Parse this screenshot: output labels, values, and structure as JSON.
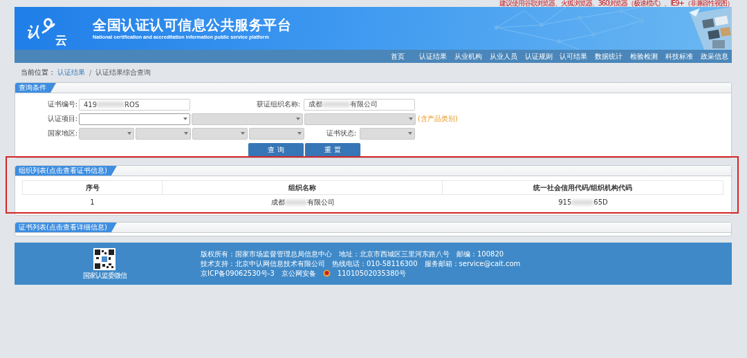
{
  "browser_notice": "建议使用谷歌浏览器、火狐浏览器、360浏览器（极速模式）、IE9+（非兼容性视图）",
  "header": {
    "logo_chars": [
      "认",
      "云"
    ],
    "title": "全国认证认可信息公共服务平台",
    "subtitle": "National certification and accreditation information public service platform"
  },
  "nav": [
    {
      "label": "首页",
      "selected": false
    },
    {
      "label": "认证结果",
      "selected": false
    },
    {
      "label": "从业机构",
      "selected": false
    },
    {
      "label": "从业人员",
      "selected": false
    },
    {
      "label": "认证规则",
      "selected": false
    },
    {
      "label": "认可结果",
      "selected": false
    },
    {
      "label": "数据统计",
      "selected": false
    },
    {
      "label": "检验检测",
      "selected": false
    },
    {
      "label": "科技标准",
      "selected": false
    },
    {
      "label": "政采信息",
      "selected": false
    }
  ],
  "breadcrumb": {
    "label": "当前位置：",
    "separator": "/",
    "items": [
      "认证结果",
      "认证结果综合查询"
    ]
  },
  "query_panel": {
    "title": "查询条件",
    "rows": [
      {
        "label": "证书编号:",
        "fields": [
          {
            "kind": "text",
            "value_start": "419",
            "blurred": true,
            "value_end": "ROS",
            "disabled": false
          }
        ],
        "label2": "获证组织名称:",
        "fields2": [
          {
            "kind": "text",
            "value_start": "成都",
            "blurred": true,
            "value_end": "有限公司",
            "disabled": false
          }
        ]
      },
      {
        "label": "认证项目:",
        "fields": [
          {
            "kind": "select",
            "disabled": false
          },
          {
            "kind": "select",
            "disabled": true
          },
          {
            "kind": "select",
            "disabled": true
          }
        ],
        "hint": "(含产品类别)"
      },
      {
        "label": "国家地区:",
        "fields": [
          {
            "kind": "select",
            "disabled": true
          },
          {
            "kind": "select",
            "disabled": true
          },
          {
            "kind": "select",
            "disabled": true
          },
          {
            "kind": "select",
            "disabled": true
          }
        ],
        "label2": "证书状态:",
        "fields2": [
          {
            "kind": "select",
            "disabled": true
          }
        ]
      }
    ],
    "buttons": [
      "查 询",
      "重 置"
    ]
  },
  "org_panel": {
    "title": "组织列表(点击查看证书信息)",
    "highlighted": true,
    "table": {
      "columns": [
        "序号",
        "组织名称",
        "统一社会信用代码/组织机构代码"
      ],
      "rows": [
        [
          {
            "start": "1",
            "blurred": false
          },
          {
            "start": "成都",
            "blurred": true,
            "end": "有限公司"
          },
          {
            "start": "915",
            "blurred": true,
            "end": "65D"
          }
        ]
      ]
    }
  },
  "cert_panel": {
    "title": "证书列表(点击查看详细信息)"
  },
  "footer": {
    "qr_caption": "国家认监委微信",
    "lines": [
      [
        "版权所有：国家市场监督管理总局信息中心",
        "地址：北京市西城区三里河东路八号",
        "邮编：100820"
      ],
      [
        "技术支持：北京中认网信息技术有限公司",
        "热线电话：010-58116300",
        "服务邮箱：service@cait.com"
      ],
      [
        "京ICP备09062530号-3",
        "京公网安备",
        "11010502035380号"
      ]
    ]
  }
}
